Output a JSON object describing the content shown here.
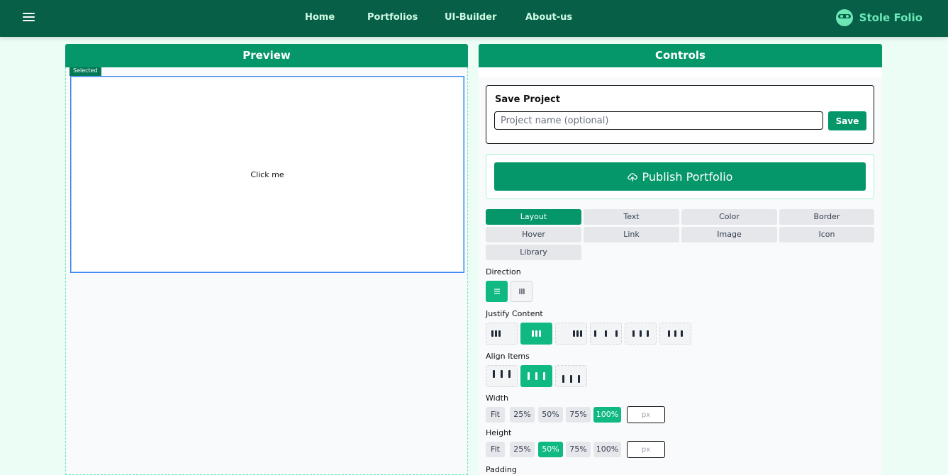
{
  "nav": {
    "links": [
      "Home",
      "Portfolios",
      "UI-Builder",
      "About-us"
    ],
    "brand": "Stole Folio"
  },
  "preview": {
    "title": "Preview",
    "selected_tag": "Selected",
    "element_text": "Click me"
  },
  "controls": {
    "title": "Controls",
    "save": {
      "title": "Save Project",
      "placeholder": "Project name (optional)",
      "value": "",
      "button": "Save"
    },
    "publish": {
      "label": "Publish Portfolio"
    },
    "tabs": [
      "Layout",
      "Text",
      "Color",
      "Border",
      "Hover",
      "Link",
      "Image",
      "Icon",
      "Library"
    ],
    "active_tab": "Layout",
    "labels": {
      "direction": "Direction",
      "justify": "Justify Content",
      "align": "Align Items",
      "width": "Width",
      "height": "Height",
      "padding": "Padding"
    },
    "direction_options": [
      "row",
      "column"
    ],
    "direction_active": "row",
    "justify_options": [
      "flex-start",
      "center",
      "flex-end",
      "space-between",
      "space-around",
      "space-evenly"
    ],
    "justify_active": "center",
    "align_options": [
      "flex-start",
      "center",
      "flex-end"
    ],
    "align_active": "center",
    "width_options": [
      "Fit",
      "25%",
      "50%",
      "75%",
      "100%"
    ],
    "width_active": "100%",
    "height_options": [
      "Fit",
      "25%",
      "50%",
      "75%",
      "100%"
    ],
    "height_active": "50%",
    "px_placeholder": "px"
  },
  "colors": {
    "nav_bg": "#065f46",
    "brand": "#6ee7b7",
    "primary": "#059669",
    "accent": "#10b981",
    "page_bg": "#ecfdf5"
  }
}
